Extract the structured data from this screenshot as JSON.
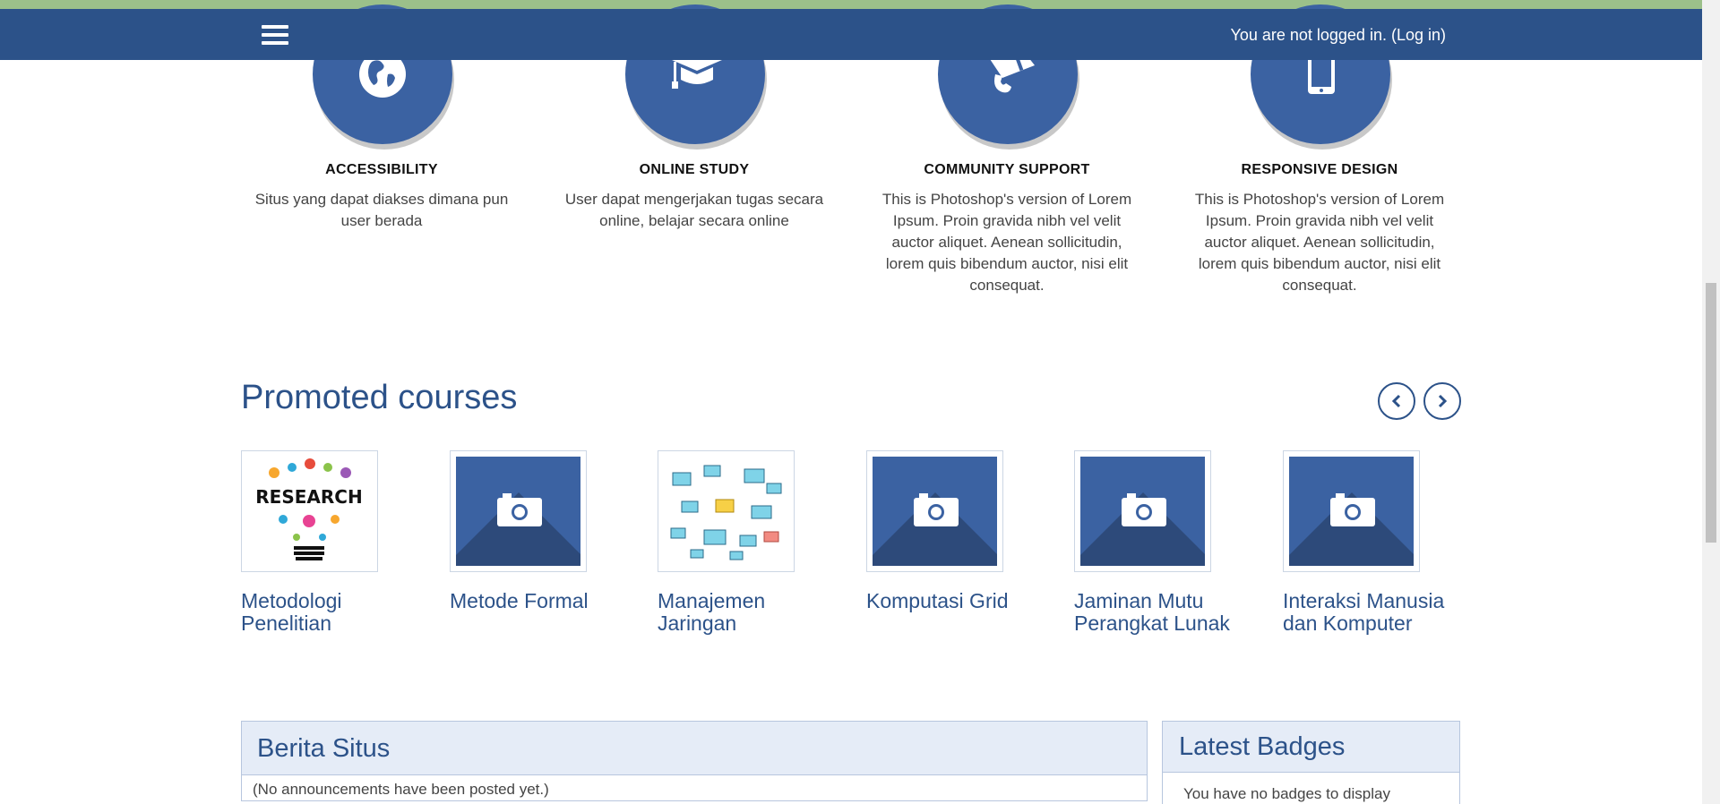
{
  "header": {
    "login_prefix": "You are not logged in. (",
    "login_link": "Log in",
    "login_suffix": ")"
  },
  "features": [
    {
      "icon": "globe-icon",
      "title": "ACCESSIBILITY",
      "description": "Situs yang dapat diakses dimana pun user berada"
    },
    {
      "icon": "graduation-cap-icon",
      "title": "ONLINE STUDY",
      "description": "User dapat mengerjakan tugas secara online, belajar secara online"
    },
    {
      "icon": "megaphone-icon",
      "title": "COMMUNITY SUPPORT",
      "description": "This is Photoshop's version of Lorem Ipsum. Proin gravida nibh vel velit auctor aliquet. Aenean sollicitudin, lorem quis bibendum auctor, nisi elit consequat."
    },
    {
      "icon": "mobile-phone-icon",
      "title": "RESPONSIVE DESIGN",
      "description": "This is Photoshop's version of Lorem Ipsum. Proin gravida nibh vel velit auctor aliquet. Aenean sollicitudin, lorem quis bibendum auctor, nisi elit consequat."
    }
  ],
  "promoted": {
    "title": "Promoted courses",
    "prev_icon": "chevron-left-icon",
    "next_icon": "chevron-right-icon",
    "courses": [
      {
        "name": "Metodologi Penelitian",
        "image": "research-illustration",
        "image_text": "RESEARCH"
      },
      {
        "name": "Metode Formal",
        "image": "camera-placeholder-icon"
      },
      {
        "name": "Manajemen Jaringan",
        "image": "network-devices-illustration"
      },
      {
        "name": "Komputasi Grid",
        "image": "camera-placeholder-icon"
      },
      {
        "name": "Jaminan Mutu Perangkat Lunak",
        "image": "camera-placeholder-icon"
      },
      {
        "name": "Interaksi Manusia dan Komputer",
        "image": "camera-placeholder-icon"
      }
    ]
  },
  "news": {
    "title": "Berita Situs",
    "empty_text": "(No announcements have been posted yet.)"
  },
  "badges": {
    "title": "Latest Badges",
    "empty_text": "You have no badges to display"
  },
  "colors": {
    "navbar": "#2c5289",
    "accent_circle": "#3b62a2",
    "top_strip": "#9bc08a",
    "block_header_bg": "#e5ecf7"
  }
}
